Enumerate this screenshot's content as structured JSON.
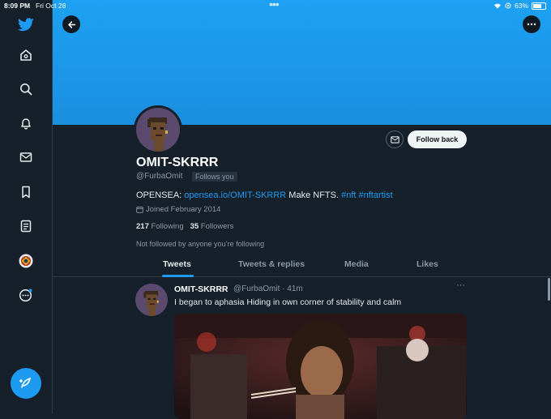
{
  "status_bar": {
    "time": "8:09 PM",
    "date": "Fri Oct 28",
    "battery": "63%",
    "battery_level": 0.63
  },
  "sidebar": {
    "items": [
      "twitter-logo",
      "home",
      "explore",
      "notifications",
      "messages",
      "bookmarks",
      "lists",
      "profile",
      "more"
    ],
    "compose_icon": "compose-tweet-icon"
  },
  "profile": {
    "name": "OMIT-SKRRR",
    "handle": "@FurbaOmit",
    "follows_you": "Follows you",
    "bio_prefix": "OPENSEA: ",
    "bio_link": "opensea.io/OMIT-SKRRR",
    "bio_middle": " Make NFTS. ",
    "bio_tag1": "#nft",
    "bio_tag2": "#nftartist",
    "joined": "Joined February 2014",
    "following_count": "217",
    "following_label": " Following",
    "followers_count": "35",
    "followers_label": " Followers",
    "not_followed": "Not followed by anyone you’re following",
    "follow_back_label": "Follow back"
  },
  "tabs": [
    "Tweets",
    "Tweets & replies",
    "Media",
    "Likes"
  ],
  "active_tab": "Tweets",
  "tweet": {
    "name": "OMIT-SKRRR",
    "handle_time": "@FurbaOmit · 41m",
    "more": "···",
    "text": "I began to aphasia Hiding in own corner of stability and calm"
  },
  "colors": {
    "accent": "#1d9bf0",
    "background": "#15202b",
    "banner": "#1da1f2"
  }
}
